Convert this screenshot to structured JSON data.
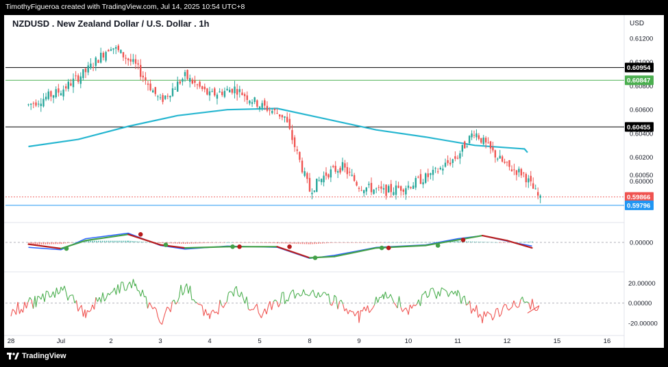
{
  "header": {
    "credit": "TimothyFigueroa created with TradingView.com, Jul 14, 2025 10:54 UTC+8",
    "title": "NZDUSD . New Zealand Dollar / U.S. Dollar . 1h",
    "currency": "USD"
  },
  "footer": {
    "brand": "TradingView"
  },
  "colors": {
    "bull": "#26a69a",
    "bear": "#ef5350",
    "ma": "#26b6d0",
    "macd_line": "#2962ff",
    "signal_green": "#43a047",
    "signal_red": "#b71c1c",
    "osc_green": "#4caf50",
    "osc_red": "#ef5350"
  },
  "chart_data": [
    {
      "type": "candlestick",
      "title": "NZDUSD . New Zealand Dollar / U.S. Dollar . 1h",
      "x_ticks": [
        "28",
        "Jul",
        "2",
        "3",
        "4",
        "5",
        "8",
        "9",
        "10",
        "11",
        "12",
        "15",
        "16"
      ],
      "y_ticks": [
        0.6,
        0.6005,
        0.602,
        0.604,
        0.606,
        0.608,
        0.61,
        0.612
      ],
      "y_tick_labels": [
        "0.60000",
        "0.60050",
        "0.60200",
        "0.60400",
        "0.60600",
        "0.60800",
        "0.61000",
        "0.61200"
      ],
      "ylim": [
        0.5968,
        0.6128
      ],
      "close_path": [
        [
          "28",
          0.6064
        ],
        [
          "Jul",
          0.6076
        ],
        [
          "Jul",
          0.6092
        ],
        [
          "2",
          0.6114
        ],
        [
          "2",
          0.6097
        ],
        [
          "3",
          0.6067
        ],
        [
          "3",
          0.6088
        ],
        [
          "4",
          0.6072
        ],
        [
          "4",
          0.6078
        ],
        [
          "5",
          0.6064
        ],
        [
          "5",
          0.6054
        ],
        [
          "8",
          0.5992
        ],
        [
          "8",
          0.6006
        ],
        [
          "8",
          0.6012
        ],
        [
          "9",
          0.5996
        ],
        [
          "9",
          0.5991
        ],
        [
          "10",
          0.5996
        ],
        [
          "10",
          0.6006
        ],
        [
          "11",
          0.6021
        ],
        [
          "11",
          0.6042
        ],
        [
          "11",
          0.6026
        ],
        [
          "12",
          0.6012
        ],
        [
          "12",
          0.6006
        ],
        [
          "12",
          0.5984
        ]
      ],
      "moving_average": [
        [
          "28",
          0.6029
        ],
        [
          "Jul",
          0.6035
        ],
        [
          "2",
          0.6046
        ],
        [
          "3",
          0.6055
        ],
        [
          "4",
          0.606
        ],
        [
          "5",
          0.6061
        ],
        [
          "8",
          0.6052
        ],
        [
          "9",
          0.6043
        ],
        [
          "10",
          0.6037
        ],
        [
          "11",
          0.603
        ],
        [
          "12",
          0.6027
        ]
      ],
      "horizontal_lines": [
        {
          "price": 0.60954,
          "label": "0.60954",
          "color": "#000000"
        },
        {
          "price": 0.60847,
          "label": "0.60847",
          "color": "#4caf50"
        },
        {
          "price": 0.60455,
          "label": "0.60455",
          "color": "#000000"
        },
        {
          "price": 0.59866,
          "label": "0.59866",
          "color": "#ef5350"
        },
        {
          "price": 0.59796,
          "label": "0.59796",
          "color": "#2196f3"
        }
      ]
    },
    {
      "type": "line",
      "name": "macd",
      "y_ticks": [
        0.0
      ],
      "y_tick_labels": [
        "0.00000"
      ],
      "macd": [
        [
          "28",
          -0.8
        ],
        [
          "Jul",
          -1.2
        ],
        [
          "Jul",
          0.6
        ],
        [
          "2",
          1.5
        ],
        [
          "3",
          -0.5
        ],
        [
          "3",
          -1.1
        ],
        [
          "4",
          -0.6
        ],
        [
          "5",
          -0.8
        ],
        [
          "8",
          -2.6
        ],
        [
          "8",
          -2.1
        ],
        [
          "9",
          -0.8
        ],
        [
          "10",
          -0.4
        ],
        [
          "11",
          0.6
        ],
        [
          "11",
          1.1
        ],
        [
          "12",
          0.2
        ],
        [
          "12",
          -0.6
        ]
      ],
      "signal": [
        [
          "28",
          -0.3
        ],
        [
          "Jul",
          -1.0
        ],
        [
          "Jul",
          0.3
        ],
        [
          "2",
          1.3
        ],
        [
          "3",
          -0.4
        ],
        [
          "3",
          -0.9
        ],
        [
          "4",
          -0.7
        ],
        [
          "5",
          -0.7
        ],
        [
          "8",
          -2.5
        ],
        [
          "8",
          -2.3
        ],
        [
          "9",
          -0.9
        ],
        [
          "10",
          -0.5
        ],
        [
          "11",
          0.4
        ],
        [
          "11",
          1.1
        ],
        [
          "12",
          0.3
        ],
        [
          "12",
          -0.9
        ]
      ],
      "cross_markers": [
        {
          "x": "Jul",
          "kind": "bull"
        },
        {
          "x": "2",
          "kind": "bear"
        },
        {
          "x": "3",
          "kind": "bull"
        },
        {
          "x": "4",
          "kind": "bear"
        },
        {
          "x": "4",
          "kind": "bull"
        },
        {
          "x": "5",
          "kind": "bear"
        },
        {
          "x": "8",
          "kind": "bull"
        },
        {
          "x": "9",
          "kind": "bear"
        },
        {
          "x": "9",
          "kind": "bull"
        },
        {
          "x": "10",
          "kind": "bull"
        },
        {
          "x": "11",
          "kind": "bear"
        }
      ]
    },
    {
      "type": "line",
      "name": "oscillator",
      "y_ticks": [
        20,
        0,
        -20
      ],
      "y_tick_labels": [
        "20.00000",
        "0.00000",
        "-20.00000"
      ],
      "ylim": [
        -27,
        28
      ],
      "values": [
        [
          "28",
          -8
        ],
        [
          "28",
          2
        ],
        [
          "Jul",
          15
        ],
        [
          "Jul",
          -10
        ],
        [
          "2",
          13
        ],
        [
          "2",
          18
        ],
        [
          "3",
          -17
        ],
        [
          "3",
          18
        ],
        [
          "4",
          -14
        ],
        [
          "4",
          12
        ],
        [
          "5",
          -10
        ],
        [
          "5",
          6
        ],
        [
          "8",
          13
        ],
        [
          "8",
          2
        ],
        [
          "9",
          -13
        ],
        [
          "9",
          9
        ],
        [
          "10",
          -5
        ],
        [
          "10",
          12
        ],
        [
          "11",
          8
        ],
        [
          "11",
          -14
        ],
        [
          "12",
          -6
        ],
        [
          "12",
          5
        ],
        [
          "12",
          -10
        ]
      ]
    }
  ]
}
